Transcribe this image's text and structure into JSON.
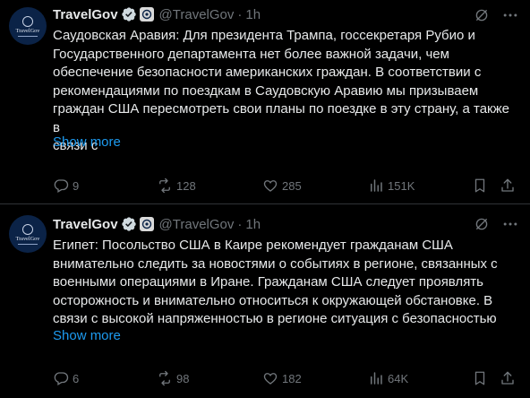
{
  "tweets": [
    {
      "author_name": "TravelGov",
      "avatar_text": "TravelGov",
      "handle": "@TravelGov",
      "dot": "·",
      "time": "1h",
      "lines": [
        "Саудовская Аравия: Для президента Трампа, госсекретаря Рубио и",
        "Государственного департамента нет более важной задачи, чем",
        "обеспечение безопасности американских граждан. В соответствии с",
        "рекомендациями по поездкам в Саудовскую Аравию мы призываем",
        "граждан США пересмотреть свои планы по поездке в эту страну, а также в",
        "связи с"
      ],
      "show_more": "Show more",
      "replies": "9",
      "reposts": "128",
      "likes": "285",
      "views": "151K"
    },
    {
      "author_name": "TravelGov",
      "avatar_text": "TravelGov",
      "handle": "@TravelGov",
      "dot": "·",
      "time": "1h",
      "lines": [
        "Египет: Посольство США в Каире рекомендует гражданам США",
        "внимательно следить за новостями о событиях в регионе, связанных с",
        "военными операциями в Иране. Гражданам США следует проявлять",
        "осторожность и внимательно относиться к окружающей обстановке. В",
        "связи с высокой напряженностью в регионе ситуация с безопасностью"
      ],
      "show_more": "Show more",
      "replies": "6",
      "reposts": "98",
      "likes": "182",
      "views": "64K"
    }
  ],
  "colors": {
    "background": "#000000",
    "text": "#e7e9ea",
    "muted": "#71767b",
    "link": "#1d9bf0",
    "verified": "#1d9bf0",
    "divider": "#2f3336"
  },
  "icons": {
    "reply": "reply-icon",
    "repost": "repost-icon",
    "like": "like-icon",
    "views": "views-icon",
    "bookmark": "bookmark-icon",
    "share": "share-icon",
    "grok": "grok-icon",
    "more": "more-icon",
    "verified": "verified-badge-icon",
    "gov": "government-badge-icon"
  }
}
